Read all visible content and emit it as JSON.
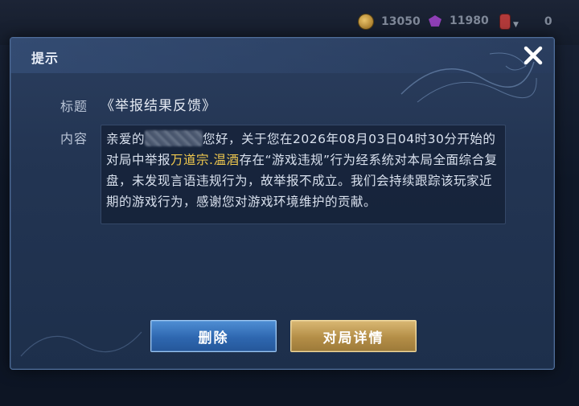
{
  "topbar": {
    "gold": "13050",
    "gems": "11980",
    "tickets": "0"
  },
  "dialog": {
    "title": "提示",
    "subject_label": "标题",
    "subject": "《举报结果反馈》",
    "content_label": "内容",
    "content": {
      "part1": "亲爱的",
      "part2": "您好，关于您在2026年08月03日04时30分开始的对局中举报",
      "reported_player": "万道宗.温酒",
      "part3": "存在“游戏违规”行为经系统对本局全面综合复盘，未发现言语违规行为，故举报不成立。我们会持续跟踪该玩家近期的游戏行为，感谢您对游戏环境维护的贡献。"
    },
    "buttons": {
      "delete": "删除",
      "match_details": "对局详情"
    }
  },
  "colors": {
    "highlight": "#f0c94e",
    "delete_button": "#2e67b0",
    "detail_button": "#b48e47"
  }
}
